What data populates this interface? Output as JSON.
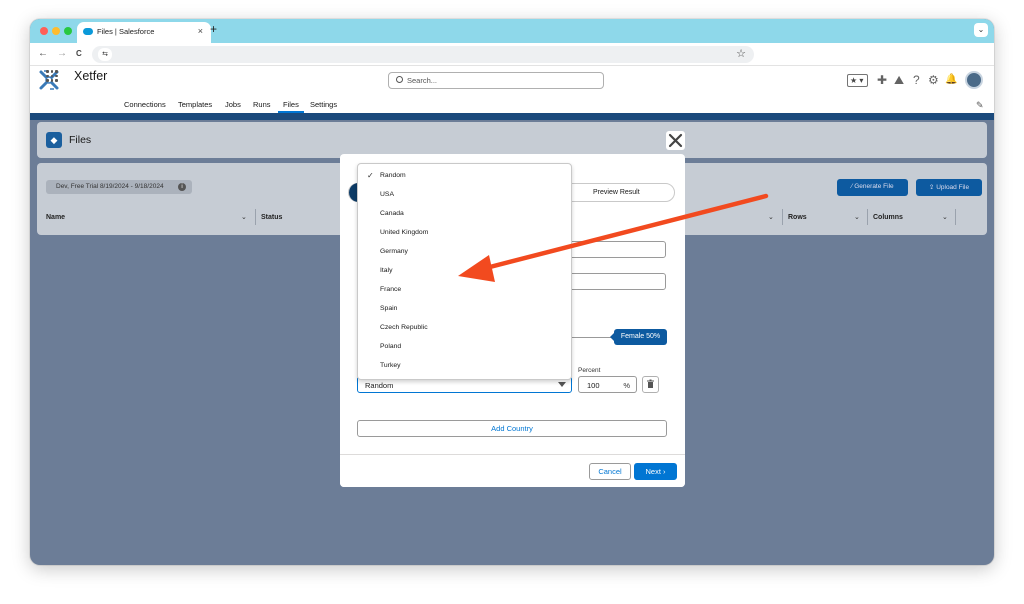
{
  "browser": {
    "tab_title": "Files | Salesforce",
    "tab_close": "×",
    "new_tab": "+",
    "back": "←",
    "forward": "→",
    "reload": "C",
    "site_info": "⇆",
    "bookmark": "☆",
    "profile_menu": "⌄",
    "traffic_colors": [
      "#ff5f57",
      "#febc2e",
      "#28c840"
    ]
  },
  "header": {
    "search_placeholder": "Search...",
    "favorites": "★ ▾",
    "add": "✚",
    "help": "?",
    "setup": "⚙",
    "notifications": "🔔",
    "trailhead": "⛰"
  },
  "app": {
    "name": "Xetfer",
    "nav": [
      "Connections",
      "Templates",
      "Jobs",
      "Runs",
      "Files",
      "Settings"
    ],
    "nav_selected": "Files",
    "edit": "✎",
    "accent": "#0176d3"
  },
  "page": {
    "title": "Files",
    "trial": "Dev, Free Trial 8/19/2024 - 9/18/2024",
    "trial_info": "i",
    "generate_file": "Generate File",
    "upload_file": "Upload File",
    "columns": [
      "Name",
      "Status",
      "Rows",
      "Columns"
    ]
  },
  "modal": {
    "close": "✕",
    "preview_step": "Preview Result",
    "gender_badge": "Female 50%",
    "country_value": "Random",
    "percent_label": "Percent",
    "percent_value": "100",
    "percent_symbol": "%",
    "add_country": "Add Country",
    "cancel": "Cancel",
    "next": "Next",
    "next_chevron": "›"
  },
  "country_dropdown": {
    "selected": "Random",
    "check": "✓",
    "options": [
      "Random",
      "USA",
      "Canada",
      "United Kingdom",
      "Germany",
      "Italy",
      "France",
      "Spain",
      "Czech Republic",
      "Poland",
      "Turkey"
    ]
  },
  "annotation": {
    "arrow_color": "#f24a1f"
  }
}
